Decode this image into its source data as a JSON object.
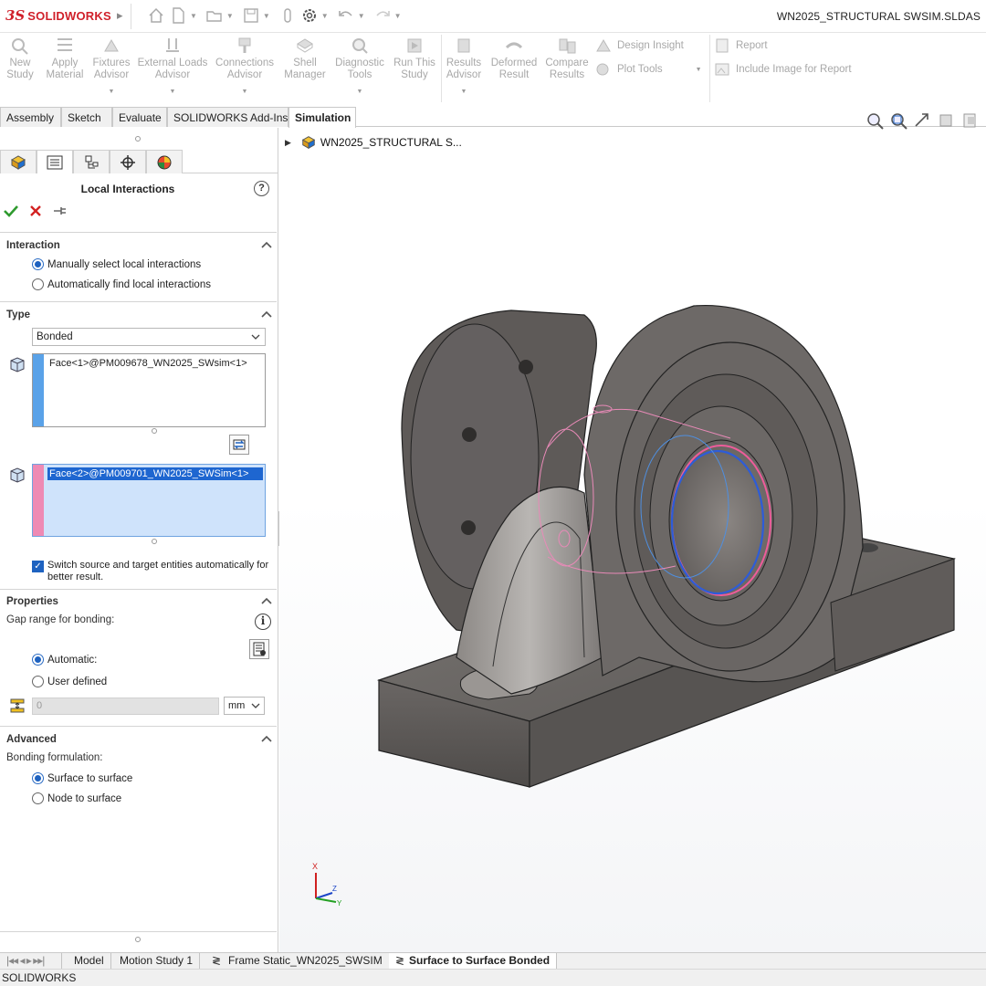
{
  "app": {
    "logo_mark": "3S",
    "logo_text": "SOLIDWORKS",
    "document_title": "WN2025_STRUCTURAL SWSIM.SLDAS"
  },
  "quick_access": [
    "home-icon",
    "new-document-icon",
    "open-icon",
    "save-icon",
    "print-icon",
    "options-gear-icon",
    "undo-icon",
    "redo-icon"
  ],
  "ribbon": {
    "new_study": [
      "New",
      "Study"
    ],
    "apply_material": [
      "Apply",
      "Material"
    ],
    "fixtures_advisor": [
      "Fixtures",
      "Advisor"
    ],
    "external_loads": [
      "External Loads",
      "Advisor"
    ],
    "connections": [
      "Connections",
      "Advisor"
    ],
    "shell_manager": [
      "Shell",
      "Manager"
    ],
    "diagnostic_tools": [
      "Diagnostic",
      "Tools"
    ],
    "run_study": [
      "Run This",
      "Study"
    ],
    "results_advisor": [
      "Results",
      "Advisor"
    ],
    "deformed_result": [
      "Deformed",
      "Result"
    ],
    "compare_results": [
      "Compare",
      "Results"
    ],
    "design_insight": "Design Insight",
    "plot_tools": "Plot Tools",
    "report": "Report",
    "include_image": "Include Image for Report"
  },
  "command_tabs": [
    "Assembly",
    "Sketch",
    "Evaluate",
    "SOLIDWORKS Add-Ins",
    "Simulation"
  ],
  "active_command_tab": "Simulation",
  "property_manager": {
    "title": "Local Interactions",
    "help": "?",
    "interaction": {
      "title": "Interaction",
      "option_manual": "Manually select local interactions",
      "option_auto": "Automatically find local interactions",
      "selected": "manual"
    },
    "type": {
      "title": "Type",
      "value": "Bonded",
      "source_entity": "Face<1>@PM009678_WN2025_SWsim<1>",
      "target_entity": "Face<2>@PM009701_WN2025_SWSim<1>",
      "switch_label": "Switch source and target entities automatically for better result.",
      "switch_checked": true
    },
    "properties": {
      "title": "Properties",
      "gap_label": "Gap range for bonding:",
      "option_automatic": "Automatic:",
      "option_user": "User defined",
      "selected": "automatic",
      "gap_value": "0",
      "unit": "mm"
    },
    "advanced": {
      "title": "Advanced",
      "formulation_label": "Bonding formulation:",
      "option_surface": "Surface to surface",
      "option_node": "Node to surface",
      "selected": "surface"
    }
  },
  "graphics": {
    "tree_root": "WN2025_STRUCTURAL S..."
  },
  "bottom_tabs": [
    "Model",
    "Motion Study 1",
    "Frame Static_WN2025_SWSIM",
    "Surface to Surface Bonded"
  ],
  "active_bottom_tab": "Surface to Surface Bonded",
  "status_text": "SOLIDWORKS",
  "colors": {
    "brand_red": "#d0202a",
    "accent_blue": "#1e62c0",
    "source_strip": "#5aa2e8",
    "target_strip": "#ee8ab4",
    "model_gray": "#6f6b68"
  }
}
